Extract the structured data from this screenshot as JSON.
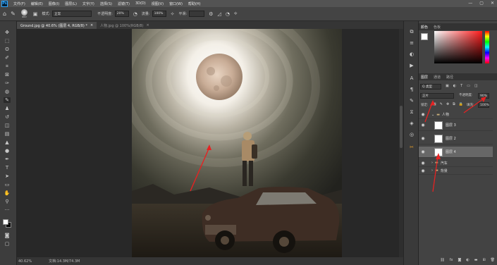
{
  "app": {
    "logo": "Ps"
  },
  "menu": [
    "文件(F)",
    "编辑(E)",
    "图像(I)",
    "图层(L)",
    "文字(Y)",
    "选择(S)",
    "滤镜(T)",
    "3D(D)",
    "视图(V)",
    "窗口(W)",
    "帮助(H)"
  ],
  "window_controls": {
    "minimize": "—",
    "maximize": "▢",
    "close": "✕"
  },
  "options": {
    "brush_size": "400",
    "mode_label": "模式:",
    "mode_value": "正常",
    "opacity_label": "不透明度:",
    "opacity_value": "20%",
    "flow_label": "流量:",
    "flow_value": "100%",
    "smoothing_label": "平滑:"
  },
  "tabs": [
    {
      "label": "Ground.jpg @ 40.6% (图层 4, RGB/8) *",
      "close": "×"
    },
    {
      "label": "人物.jpg @ 100%(RGB/8)",
      "close": "×"
    }
  ],
  "status": {
    "zoom": "40.62%",
    "doc": "文档:14.3M/74.3M"
  },
  "panels": {
    "color_tabs": [
      "颜色",
      "色板"
    ],
    "layer_tabs": [
      "图层",
      "通道",
      "路径"
    ],
    "kind_filter": "Q 类型",
    "blend_mode": "正片",
    "opacity_label": "不透明度:",
    "opacity_value": "90%",
    "lock_label": "锁定:",
    "fill_label": "填充:",
    "fill_value": "100%"
  },
  "layers": [
    {
      "name": "人物",
      "type": "group",
      "selected": false
    },
    {
      "name": "图层 3",
      "type": "layer",
      "selected": false
    },
    {
      "name": "图层 2",
      "type": "layer",
      "selected": false
    },
    {
      "name": "图层 4",
      "type": "layer",
      "selected": true
    },
    {
      "name": "汽车",
      "type": "group",
      "selected": false
    },
    {
      "name": "背景",
      "type": "group",
      "selected": false
    }
  ],
  "colors": {
    "foreground": "#ffffff",
    "background": "#000000",
    "annotation_arrow": "#e52222"
  }
}
